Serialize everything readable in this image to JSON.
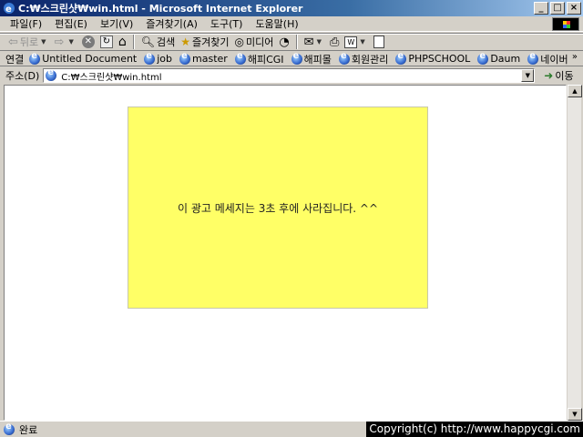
{
  "window": {
    "title": "C:₩스크린샷₩win.html - Microsoft Internet Explorer",
    "buttons": [
      "_",
      "□",
      "×"
    ]
  },
  "menu": [
    "파일(F)",
    "편집(E)",
    "보기(V)",
    "즐겨찾기(A)",
    "도구(T)",
    "도움말(H)"
  ],
  "toolbar": {
    "back": "뒤로",
    "search": "검색",
    "favorites": "즐겨찾기",
    "media": "미디어"
  },
  "links": {
    "title": "연결",
    "items": [
      "Untitled Document",
      "job",
      "master",
      "해피CGI",
      "해피몰",
      "회원관리",
      "PHPSCHOOL",
      "Daum",
      "네이버"
    ],
    "more": "»"
  },
  "address": {
    "label": "주소(D)",
    "value": "C:₩스크린샷₩win.html",
    "go": "이동"
  },
  "content": {
    "message": "이 광고 메세지는 3초 후에 사라집니다. ^^"
  },
  "status": {
    "text": "완료"
  },
  "overlay": {
    "copyright": "Copyright(c) http://www.happycgi.com"
  }
}
